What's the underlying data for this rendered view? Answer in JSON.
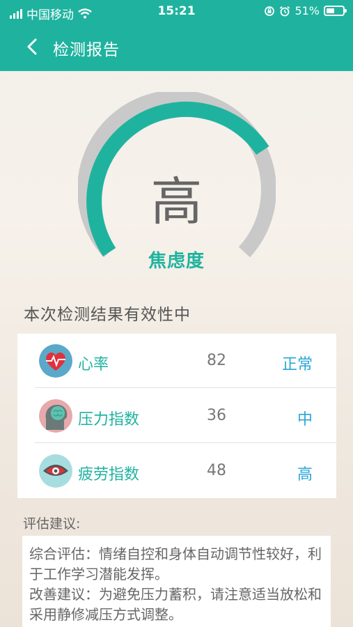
{
  "status_bar": {
    "carrier": "中国移动",
    "time": "15:21",
    "battery": "51%",
    "battery_level": 0.51
  },
  "header": {
    "title": "检测报告",
    "back_icon": "chevron-left-icon"
  },
  "gauge": {
    "value_text": "高",
    "label": "焦虑度",
    "fill_color": "#1fb39f",
    "track_color": "#c9c9c9"
  },
  "validity_text": "本次检测结果有效性中",
  "metrics": [
    {
      "name": "心率",
      "value": "82",
      "level": "正常",
      "icon": "heart-rate-icon"
    },
    {
      "name": "压力指数",
      "value": "36",
      "level": "中",
      "icon": "brain-icon"
    },
    {
      "name": "疲劳指数",
      "value": "48",
      "level": "高",
      "icon": "eye-icon"
    }
  ],
  "advice": {
    "title": "评估建议:",
    "line1": "综合评估：情绪自控和身体自动调节性较好，利于工作学习潜能发挥。",
    "line2": "改善建议：为避免压力蓄积，请注意适当放松和采用静修减压方式调整。"
  },
  "colors": {
    "accent": "#1fb39f",
    "level_text": "#29a6d8"
  }
}
